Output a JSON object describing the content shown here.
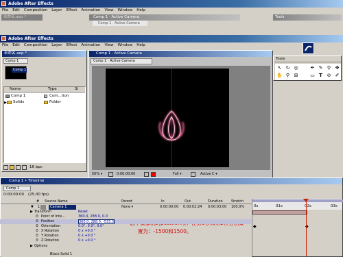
{
  "app": {
    "title": "Adobe After Effects",
    "window_title": "Adobe After Effects"
  },
  "menu": [
    "File",
    "Edit",
    "Composition",
    "Layer",
    "Effect",
    "Animation",
    "View",
    "Window",
    "Help"
  ],
  "project": {
    "title": "未命名.aep *",
    "comp_tab": "Comp 1",
    "thumb_name": "Comp 1",
    "columns": [
      "Name",
      "Type",
      "Si"
    ],
    "items": [
      {
        "name": "Comp 1",
        "type": "Com...tion"
      },
      {
        "name": "Solids",
        "type": "Folder"
      }
    ],
    "bpc": "16 bpc"
  },
  "comp_window": {
    "title": "Comp 1 · Active Camera",
    "tab": "Comp 1 · Active Camera",
    "zoom": "50%",
    "timecode": "0:00:00:00",
    "resolution": "Full",
    "view": "Active C"
  },
  "tools": {
    "title": "Tools",
    "icons": [
      "arrow-icon",
      "hand-icon",
      "zoom-icon",
      "rotate-icon",
      "camera-icon",
      "pan-behind-icon",
      "pen-icon",
      "text-icon",
      "brush-icon",
      "clone-stamp-icon",
      "eraser-icon"
    ]
  },
  "timeline": {
    "title": "Comp 1 • Timeline",
    "tab": "Comp 1",
    "timecode": "0:00:00:00",
    "fps": "(25.00 fps)",
    "columns": {
      "num": "#",
      "source": "Source Name",
      "parent": "Parent",
      "in": "In",
      "out": "Out",
      "duration": "Duration",
      "stretch": "Stretch"
    },
    "ruler": [
      "0s",
      "01s",
      "02s",
      "03s"
    ],
    "layer": {
      "num": "1",
      "name": "Camera 1",
      "parent": "None",
      "in": "0:00:00:00",
      "out": "0:00:02:24",
      "duration": "0:00:03:00",
      "stretch": "100.0%"
    },
    "props": [
      {
        "name": "Transform",
        "value": "Reset"
      },
      {
        "name": "Point of Inte...",
        "value": "360.0, 288.0, 0.0"
      },
      {
        "name": "Position",
        "value": "360.0, 288.0, -533.3"
      },
      {
        "name": "Orientation",
        "value": "0.0°, 0.0°, 0.0°"
      },
      {
        "name": "X Rotation",
        "value": "0 x +0.0 °"
      },
      {
        "name": "Y Rotation",
        "value": "0 x +0.0 °"
      },
      {
        "name": "Z Rotation",
        "value": "0 x +0.0 °"
      },
      {
        "name": "Options",
        "value": ""
      }
    ],
    "extra_layer": "Black Solid 1",
    "annotation": [
      "选中摄像机的position项，在第0秒和第2秒分别设",
      "置为：-1500和1500。"
    ]
  },
  "colors": {
    "accent": "#0a246a",
    "annotation": "#d01010",
    "playhead": "#cc2200"
  }
}
